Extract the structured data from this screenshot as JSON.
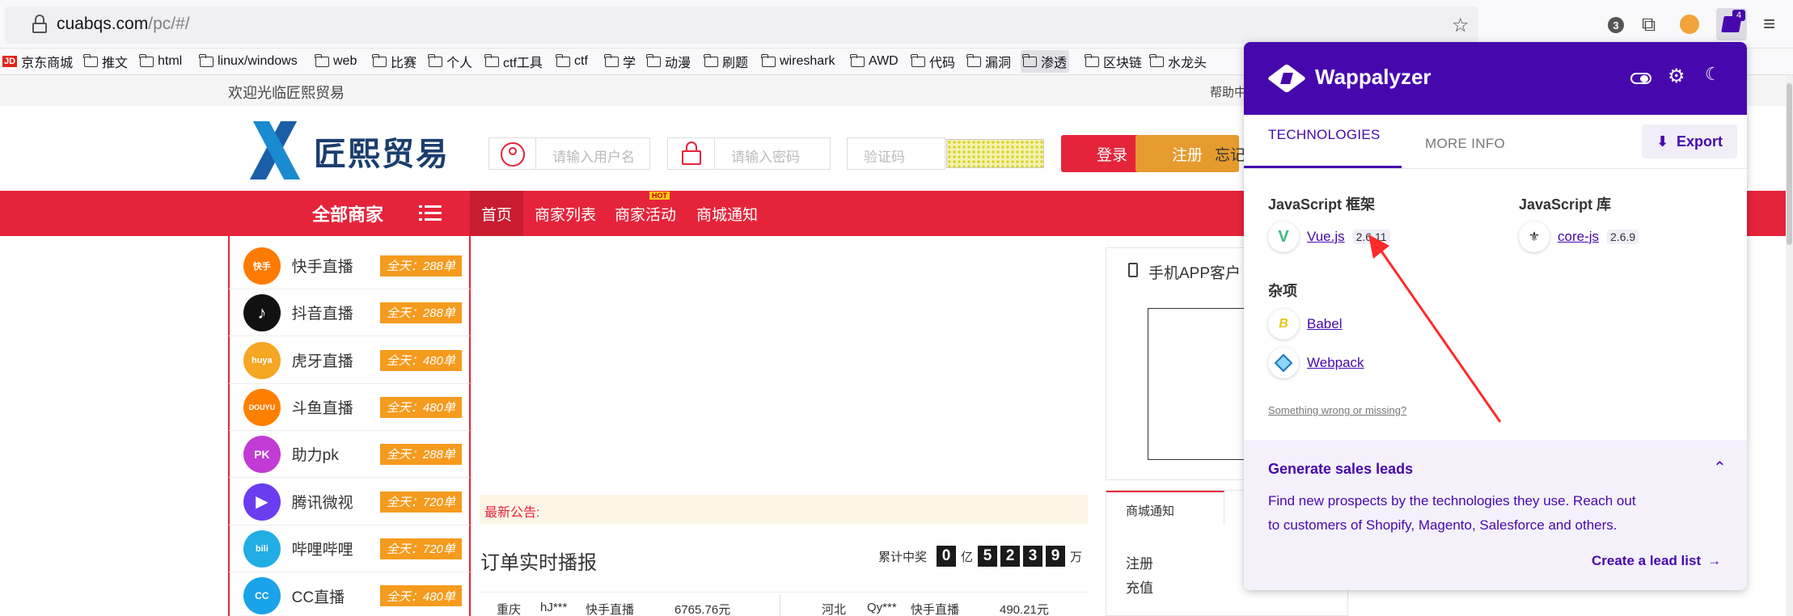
{
  "browser": {
    "url_host": "cuabqs.com",
    "url_path": "/pc/#/",
    "badge_count": "3",
    "extension_count": "4",
    "bookmarks": [
      "京东商城",
      "推文",
      "html",
      "linux/windows",
      "web",
      "比赛",
      "个人",
      "ctf工具",
      "ctf",
      "学",
      "动漫",
      "刷题",
      "wireshark",
      "AWD",
      "代码",
      "漏洞",
      "渗透",
      "区块链",
      "水龙头"
    ]
  },
  "page": {
    "welcome": "欢迎光临匠熙贸易",
    "help": "帮助中",
    "logo_text": "匠熙贸易",
    "username_placeholder": "请输入用户名",
    "password_placeholder": "请输入密码",
    "captcha_placeholder": "验证码",
    "login_label": "登录",
    "register_label": "注册",
    "forgot_label": "忘记",
    "all_merchants": "全部商家",
    "nav": [
      {
        "label": "首页"
      },
      {
        "label": "商家列表"
      },
      {
        "label": "商家活动",
        "badge": "HOT"
      },
      {
        "label": "商城通知"
      }
    ],
    "merchants": [
      {
        "name": "快手直播",
        "icon": "快手",
        "badge": "全天：288单",
        "color": "#ff7a00"
      },
      {
        "name": "抖音直播",
        "icon": "♪",
        "badge": "全天：288单",
        "color": "#111111"
      },
      {
        "name": "虎牙直播",
        "icon": "huya",
        "badge": "全天：480单",
        "color": "#f5a623"
      },
      {
        "name": "斗鱼直播",
        "icon": "DOUYU",
        "badge": "全天：480单",
        "color": "#ff7f00"
      },
      {
        "name": "助力pk",
        "icon": "PK",
        "badge": "全天：288单",
        "color": "#c23bd4"
      },
      {
        "name": "腾讯微视",
        "icon": "▶",
        "badge": "全天：720单",
        "color": "#6a3df0"
      },
      {
        "name": "哔哩哔哩",
        "icon": "bili",
        "badge": "全天：720单",
        "color": "#23ade5"
      },
      {
        "name": "CC直播",
        "icon": "CC",
        "badge": "全天：480单",
        "color": "#1aa3e8"
      }
    ],
    "notice_label": "最新公告:",
    "order_title": "订单实时播报",
    "total_label": "累计中奖",
    "total_digits": [
      "0",
      "5",
      "2",
      "3",
      "9"
    ],
    "unit_yi": "亿",
    "unit_wan": "万",
    "app_title": "手机APP客户",
    "mall_notice_tab": "商城通知",
    "side_links": [
      "注册",
      "充值"
    ],
    "order_rows": [
      {
        "region": "重庆",
        "user": "hJ***",
        "platform": "快手直播",
        "amount": "6765.76元"
      },
      {
        "region": "河北",
        "user": "Qy***",
        "platform": "快手直播",
        "amount": "490.21元"
      }
    ]
  },
  "wappalyzer": {
    "title": "Wappalyzer",
    "tab_technologies": "TECHNOLOGIES",
    "tab_more_info": "MORE INFO",
    "export_label": "Export",
    "categories": [
      {
        "name": "JavaScript 框架",
        "items": [
          {
            "name": "Vue.js",
            "version": "2.6.11"
          }
        ]
      },
      {
        "name": "JavaScript 库",
        "items": [
          {
            "name": "core-js",
            "version": "2.6.9"
          }
        ]
      },
      {
        "name": "杂项",
        "items": [
          {
            "name": "Babel",
            "version": ""
          },
          {
            "name": "Webpack",
            "version": ""
          }
        ]
      }
    ],
    "something_wrong": "Something wrong or missing?",
    "leads_title": "Generate sales leads",
    "leads_text_1": "Find new prospects by the technologies they use. Reach out",
    "leads_text_2": "to customers of Shopify, Magento, Salesforce and others.",
    "leads_cta": "Create a lead list",
    "accent_color": "#4608ad"
  }
}
